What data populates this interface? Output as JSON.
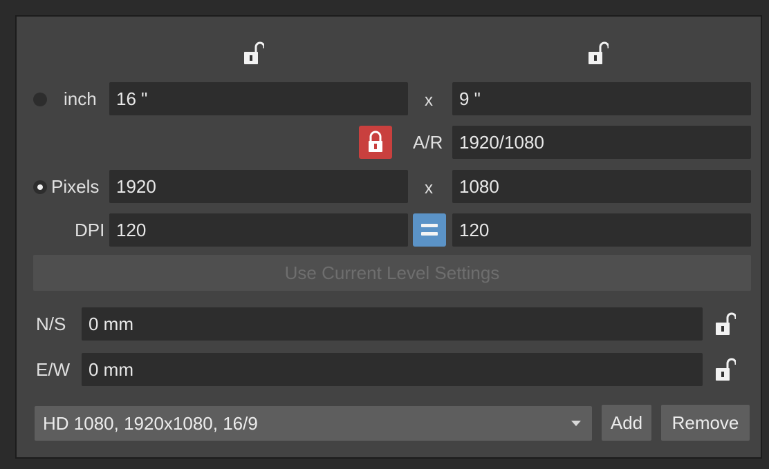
{
  "inch_row": {
    "unit_label": "inch",
    "width_value": "16 \"",
    "separator": "x",
    "height_value": "9 \""
  },
  "aspect_ratio": {
    "label": "A/R",
    "value": "1920/1080"
  },
  "pixels_row": {
    "unit_label": "Pixels",
    "width_value": "1920",
    "separator": "x",
    "height_value": "1080"
  },
  "dpi_row": {
    "label": "DPI",
    "x_value": "120",
    "y_value": "120"
  },
  "use_current_button": {
    "label": "Use Current Level Settings"
  },
  "ns_row": {
    "label": "N/S",
    "value": "0 mm"
  },
  "ew_row": {
    "label": "E/W",
    "value": "0 mm"
  },
  "preset": {
    "selected": "HD 1080, 1920x1080, 16/9"
  },
  "add_button": {
    "label": "Add"
  },
  "remove_button": {
    "label": "Remove"
  },
  "colors": {
    "panel_bg": "#434343",
    "field_bg": "#2d2d2d",
    "ar_lock_active": "#c9403e",
    "dpi_link": "#5b93c7"
  },
  "icons": [
    "unlock-icon",
    "lock-icon",
    "equals-icon",
    "dropdown-caret-icon",
    "radio-button"
  ]
}
